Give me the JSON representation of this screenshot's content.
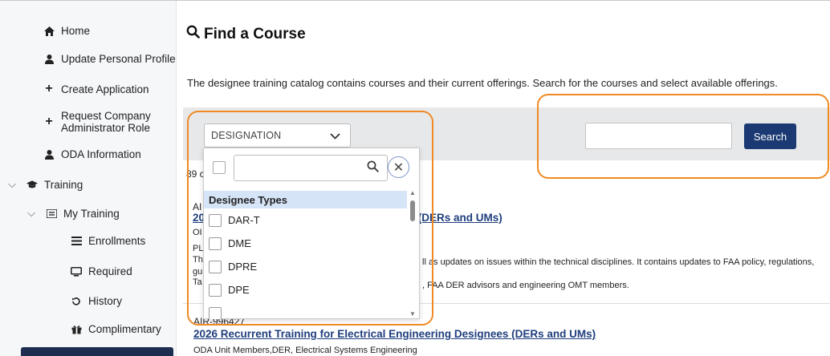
{
  "sidebar": {
    "items": [
      {
        "label": "Home",
        "icon": "home-icon"
      },
      {
        "label": "Update Personal Profile",
        "icon": "user-icon"
      },
      {
        "label": "Create Application",
        "icon": "plus-icon"
      },
      {
        "label": "Request Company Administrator Role",
        "line1": "Request Company",
        "line2": "Administrator Role",
        "icon": "plus-icon"
      },
      {
        "label": "ODA Information",
        "icon": "user-icon"
      },
      {
        "label": "Training",
        "icon": "graduation-cap-icon",
        "expanded": true
      },
      {
        "label": "My Training",
        "icon": "list-icon",
        "expanded": true
      },
      {
        "label": "Enrollments",
        "icon": "list-icon"
      },
      {
        "label": "Required",
        "icon": "monitor-icon"
      },
      {
        "label": "History",
        "icon": "history-icon"
      },
      {
        "label": "Complimentary",
        "icon": "gift-icon"
      }
    ]
  },
  "main": {
    "title": "Find a Course",
    "intro": "The designee training catalog contains courses and their current offerings. Search for the courses and select available offerings.",
    "filter": {
      "select_value": "DESIGNATION",
      "search_value": "",
      "search_button": "Search"
    },
    "result_count": "89 c",
    "courses": [
      {
        "code": "AI",
        "title_prefix": "20",
        "title_suffix": "es (DERs and UMs)",
        "meta1": "OI",
        "meta2": "PL",
        "desc_prefix": "Th",
        "desc_suffix": "ll as updates on issues within the technical disciplines. It contains updates to FAA policy, regulations,",
        "desc3": "gu",
        "desc4_prefix": "Ta",
        "desc4_suffix": ", FAA DER advisors and engineering OMT members."
      },
      {
        "code": "AIR-996427",
        "title": "2026 Recurrent Training for Electrical Engineering Designees (DERs and UMs)",
        "meta1": "ODA Unit Members,DER, Electrical Systems Engineering"
      }
    ]
  },
  "dropdown": {
    "search_value": "",
    "group_label": "Designee Types",
    "options": [
      "DAR-T",
      "DME",
      "DPRE",
      "DPE",
      ""
    ]
  },
  "colors": {
    "accent": "#1b3a73",
    "link": "#1f3e7d",
    "highlight": "#ef8a24",
    "group_bg": "#d6e4f7"
  }
}
